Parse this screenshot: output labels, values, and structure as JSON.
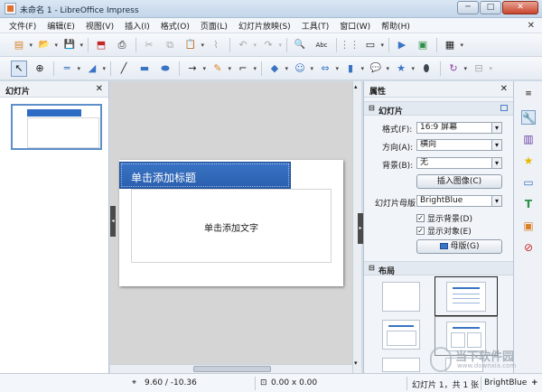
{
  "window": {
    "title": "未命名 1 - LibreOffice Impress",
    "min": "─",
    "max": "□",
    "close": "✕"
  },
  "menu": [
    "文件(F)",
    "编辑(E)",
    "视图(V)",
    "插入(I)",
    "格式(O)",
    "页面(L)",
    "幻灯片放映(S)",
    "工具(T)",
    "窗口(W)",
    "帮助(H)"
  ],
  "doc_close": "✕",
  "toolbar1": {
    "icons": [
      "new-icon",
      "open-icon",
      "save-icon",
      "pdf-export-icon",
      "print-icon",
      "cut-icon",
      "copy-icon",
      "paste-icon",
      "clone-formatting-icon",
      "undo-icon",
      "redo-icon",
      "find-replace-icon",
      "spellcheck-icon",
      "grid-icon",
      "display-views-icon",
      "start-presentation-icon",
      "new-slide-icon",
      "table-icon"
    ],
    "glyphs": {
      "new": "▤",
      "open": "📂",
      "save": "💾",
      "pdf": "⬒",
      "print": "⎙",
      "cut": "✂",
      "copy": "⧉",
      "paste": "📋",
      "clone": "⌇",
      "undo": "↶",
      "redo": "↷",
      "find": "🔍",
      "spell": "Abc",
      "grid": "⋮⋮",
      "views": "▭",
      "present": "▶",
      "slide": "▣",
      "table": "▦"
    }
  },
  "toolbar2": {
    "glyphs": {
      "select": "↖",
      "zoom": "⊕",
      "line-color": "═",
      "fill": "◢",
      "line": "╱",
      "rect": "▬",
      "ellipse": "⬬",
      "arrow": "→",
      "pencil": "✎",
      "connector": "⌐",
      "diamond": "◆",
      "smiley": "☺",
      "double-arrow": "⇔",
      "flowchart": "▮",
      "callout": "💬",
      "star": "★",
      "cylinder": "⬮",
      "rotate": "↻",
      "align": "⊟"
    }
  },
  "slides_panel": {
    "label": "幻灯片",
    "close": "✕",
    "slide_number": "1"
  },
  "slide": {
    "title_placeholder": "单击添加标题",
    "content_placeholder": "单击添加文字"
  },
  "properties": {
    "label": "属性",
    "close": "✕",
    "section_slide": {
      "label": "幻灯片",
      "toggle": "⊟"
    },
    "format_label": "格式(F):",
    "format_value": "16:9 屏幕",
    "orientation_label": "方向(A):",
    "orientation_value": "横向",
    "background_label": "背景(B):",
    "background_value": "无",
    "insert_image": "插入图像(C)",
    "master_label": "幻灯片母版",
    "master_value": "BrightBlue",
    "show_background": "显示背景(D)",
    "show_objects": "显示对象(E)",
    "check_mark": "✓",
    "master_button": "母版(G)",
    "section_layout": {
      "label": "布局",
      "toggle": "⊟"
    }
  },
  "sidebar_tabs": {
    "props": "🔧",
    "slide-transition": "▥",
    "animation": "★",
    "master-slides": "▭",
    "styles": "T",
    "gallery": "▣",
    "navigator": "⊘",
    "menu": "≡"
  },
  "status": {
    "position": "9.60 / -10.36",
    "size": "0.00 x 0.00",
    "slide_info": "幻灯片 1，共 1 张",
    "master": "BrightBlue",
    "zoom_plus": "+"
  },
  "watermark": {
    "line1": "当下软件园",
    "line2": "www.downxia.com"
  },
  "colors": {
    "title_bg": "#2a5fae",
    "accent": "#3a74c4",
    "titlebar": "#c4d6ea"
  }
}
